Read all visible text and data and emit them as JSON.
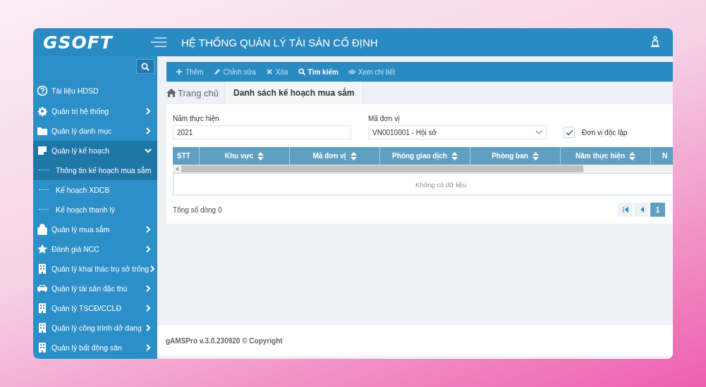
{
  "header": {
    "logo": "GSOFT",
    "title": "HỆ THỐNG QUẢN LÝ TÀI SẢN CỐ ĐỊNH"
  },
  "sidebar": {
    "items": [
      {
        "label": "Tài liệu HDSD",
        "kind": "help"
      },
      {
        "label": "Quản trị hệ thống",
        "kind": "gear",
        "expanded": false
      },
      {
        "label": "Quản lý danh mục",
        "kind": "folder",
        "expanded": false
      },
      {
        "label": "Quản lý kế hoạch",
        "kind": "note",
        "expanded": true,
        "children": [
          {
            "label": "Thông tin kế hoạch mua sắm",
            "selected": true
          },
          {
            "label": "Kế hoạch XDCB",
            "selected": false
          },
          {
            "label": "Kế hoạch thanh lý",
            "selected": false
          }
        ]
      },
      {
        "label": "Quản lý mua sắm",
        "kind": "bag",
        "expanded": false
      },
      {
        "label": "Đánh giá NCC",
        "kind": "star",
        "expanded": false
      },
      {
        "label": "Quản lý khai thác trụ sở trống",
        "kind": "building",
        "expanded": false
      },
      {
        "label": "Quản lý tài sản đặc thù",
        "kind": "car",
        "expanded": false
      },
      {
        "label": "Quản lý TSCĐ/CCLĐ",
        "kind": "building",
        "expanded": false
      },
      {
        "label": "Quản lý công trình dở dang",
        "kind": "building",
        "expanded": false
      },
      {
        "label": "Quản lý bất động sản",
        "kind": "building",
        "expanded": false
      }
    ]
  },
  "toolbar": [
    {
      "label": "Thêm",
      "kind": "plus",
      "selected": false
    },
    {
      "label": "Chỉnh sửa",
      "kind": "pencil",
      "selected": false
    },
    {
      "label": "Xóa",
      "kind": "x",
      "selected": false
    },
    {
      "label": "Tìm kiếm",
      "kind": "search",
      "selected": true
    },
    {
      "label": "Xem chi tiết",
      "kind": "eye",
      "selected": false
    }
  ],
  "breadcrumb": {
    "home": "Trang chủ",
    "current": "Danh sách kế hoạch mua sắm"
  },
  "form": {
    "year": {
      "label": "Năm thực hiện",
      "value": "2021"
    },
    "unit": {
      "label": "Mã đơn vị",
      "value": "VN0010001 - Hội sở"
    },
    "independent": {
      "label": "Đơn vị độc lập",
      "checked": true
    }
  },
  "table": {
    "columns": [
      {
        "label": "STT",
        "sortable": false
      },
      {
        "label": "Khu vực",
        "sortable": true
      },
      {
        "label": "Mã đơn vị",
        "sortable": true
      },
      {
        "label": "Phòng giao dịch",
        "sortable": true
      },
      {
        "label": "Phòng ban",
        "sortable": true
      },
      {
        "label": "Năm thực hiện",
        "sortable": true
      },
      {
        "label": "N",
        "sortable": false
      }
    ],
    "empty": "Không có dữ liệu",
    "total": "Tổng số dòng 0",
    "pages": [
      {
        "label": "1",
        "selected": true
      }
    ]
  },
  "footer": "gAMSPro v.3.0.230920 © Copyright"
}
